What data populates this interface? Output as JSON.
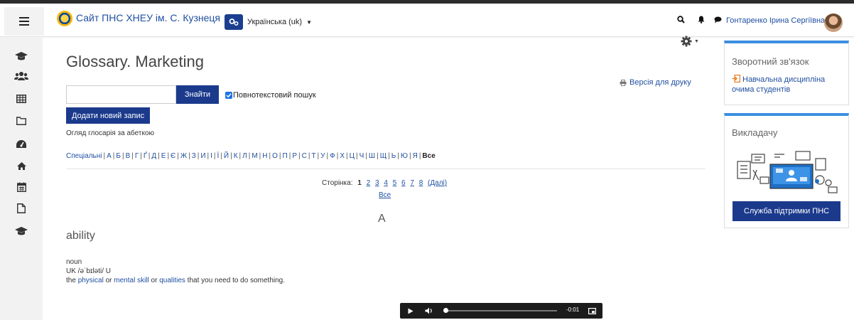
{
  "navbar": {
    "site_name": "Сайт ПНС ХНЕУ ім. С. Кузнеця",
    "language": "Українська (uk)",
    "user_name": "Гонтаренко Ірина Сергіївна"
  },
  "main": {
    "title": "Glossary. Marketing",
    "print_label": "Версія для друку",
    "search_button": "Знайти",
    "search_value": "",
    "fulltext_label": "Повнотекстовий пошук",
    "add_entry_button": "Додати новий запис",
    "browse_label": "Огляд глосарія за абеткою",
    "alphabet": [
      "Спеціальні",
      "А",
      "Б",
      "В",
      "Г",
      "Ґ",
      "Д",
      "Е",
      "Є",
      "Ж",
      "З",
      "И",
      "І",
      "Ї",
      "Й",
      "К",
      "Л",
      "М",
      "Н",
      "О",
      "П",
      "Р",
      "С",
      "Т",
      "У",
      "Ф",
      "Х",
      "Ц",
      "Ч",
      "Ш",
      "Щ",
      "Ь",
      "Ю",
      "Я"
    ],
    "alphabet_current": "Все",
    "paging": {
      "label": "Сторінка:",
      "current": "1",
      "pages": [
        "2",
        "3",
        "4",
        "5",
        "6",
        "7",
        "8"
      ],
      "next": "(Далі)",
      "all": "Все"
    },
    "letter_heading": "A",
    "entry": {
      "term": "ability",
      "pos": "noun",
      "pron": "UK /əˈbɪləti/ U",
      "def_1": "the ",
      "link_1": "physical",
      "def_2": " or ",
      "link_2": "mental skill",
      "def_3": " or ",
      "link_3": "qualities",
      "def_4": " that you need to do something."
    },
    "player": {
      "time": "-0:01",
      "progress": 0
    }
  },
  "blocks": {
    "feedback_title": "Зворотний зв'язок",
    "feedback_link": "Навчальна дисципліна очима студентів",
    "teacher_title": "Викладачу",
    "support_button": "Служба підтримки ПНС"
  },
  "icons": [
    "menu-icon",
    "graduation-cap-icon",
    "users-icon",
    "table-icon",
    "folder-icon",
    "dashboard-icon",
    "home-icon",
    "calendar-icon",
    "file-icon",
    "search-icon",
    "bell-icon",
    "chat-icon",
    "gear-icon",
    "print-icon",
    "play-icon",
    "volume-icon",
    "pip-icon"
  ],
  "colors": {
    "primary": "#1b3a8c",
    "link": "#1f4fa0",
    "block_accent": "#3c8ee0",
    "sidebar_bg": "#f2f2f2"
  }
}
